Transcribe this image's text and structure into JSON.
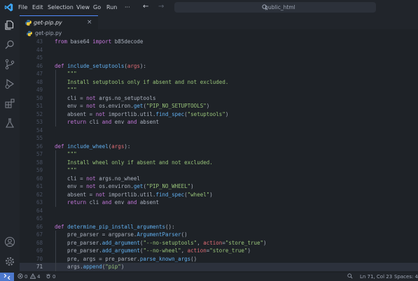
{
  "colors": {
    "accent": "#528bff",
    "remote": "#4d78cc",
    "keyword": "#c678dd",
    "function": "#61afef",
    "string": "#98c379",
    "param": "#e06c75"
  },
  "menu": [
    "File",
    "Edit",
    "Selection",
    "View",
    "Go",
    "Run",
    "···"
  ],
  "command_center": {
    "label": "public_html",
    "icon": "search-icon"
  },
  "activity_icons": [
    "explorer-icon",
    "search-icon",
    "source-control-icon",
    "run-debug-icon",
    "extensions-icon",
    "testing-icon",
    "account-icon",
    "settings-gear-icon"
  ],
  "tab": {
    "label": "get-pip.py",
    "close": "×"
  },
  "breadcrumb": {
    "file": "get-pip.py"
  },
  "editor": {
    "current_line": 71,
    "lines": [
      {
        "n": 43,
        "t": [
          [
            "kw",
            "from"
          ],
          [
            "tx",
            " base64 "
          ],
          [
            "kw",
            "import"
          ],
          [
            "tx",
            " b85decode"
          ]
        ]
      },
      {
        "n": 44,
        "t": []
      },
      {
        "n": 45,
        "t": []
      },
      {
        "n": 46,
        "t": [
          [
            "kw",
            "def"
          ],
          [
            "tx",
            " "
          ],
          [
            "fn",
            "include_setuptools"
          ],
          [
            "tx",
            "("
          ],
          [
            "pm",
            "args"
          ],
          [
            "tx",
            "):"
          ]
        ]
      },
      {
        "n": 47,
        "t": [
          [
            "st",
            "    \"\"\""
          ]
        ]
      },
      {
        "n": 48,
        "t": [
          [
            "st",
            "    Install setuptools only if absent and not excluded."
          ]
        ]
      },
      {
        "n": 49,
        "t": [
          [
            "st",
            "    \"\"\""
          ]
        ]
      },
      {
        "n": 50,
        "t": [
          [
            "tx",
            "    cli = "
          ],
          [
            "kw",
            "not"
          ],
          [
            "tx",
            " args.no_setuptools"
          ]
        ]
      },
      {
        "n": 51,
        "t": [
          [
            "tx",
            "    env = "
          ],
          [
            "kw",
            "not"
          ],
          [
            "tx",
            " os.environ."
          ],
          [
            "fn",
            "get"
          ],
          [
            "tx",
            "("
          ],
          [
            "st",
            "\"PIP_NO_SETUPTOOLS\""
          ],
          [
            "tx",
            ")"
          ]
        ]
      },
      {
        "n": 52,
        "t": [
          [
            "tx",
            "    absent = "
          ],
          [
            "kw",
            "not"
          ],
          [
            "tx",
            " importlib.util."
          ],
          [
            "fn",
            "find_spec"
          ],
          [
            "tx",
            "("
          ],
          [
            "st",
            "\"setuptools\""
          ],
          [
            "tx",
            ")"
          ]
        ]
      },
      {
        "n": 53,
        "t": [
          [
            "kw",
            "    return"
          ],
          [
            "tx",
            " cli "
          ],
          [
            "kw",
            "and"
          ],
          [
            "tx",
            " env "
          ],
          [
            "kw",
            "and"
          ],
          [
            "tx",
            " absent"
          ]
        ]
      },
      {
        "n": 54,
        "t": []
      },
      {
        "n": 55,
        "t": []
      },
      {
        "n": 56,
        "t": [
          [
            "kw",
            "def"
          ],
          [
            "tx",
            " "
          ],
          [
            "fn",
            "include_wheel"
          ],
          [
            "tx",
            "("
          ],
          [
            "pm",
            "args"
          ],
          [
            "tx",
            "):"
          ]
        ]
      },
      {
        "n": 57,
        "t": [
          [
            "st",
            "    \"\"\""
          ]
        ]
      },
      {
        "n": 58,
        "t": [
          [
            "st",
            "    Install wheel only if absent and not excluded."
          ]
        ]
      },
      {
        "n": 59,
        "t": [
          [
            "st",
            "    \"\"\""
          ]
        ]
      },
      {
        "n": 60,
        "t": [
          [
            "tx",
            "    cli = "
          ],
          [
            "kw",
            "not"
          ],
          [
            "tx",
            " args.no_wheel"
          ]
        ]
      },
      {
        "n": 61,
        "t": [
          [
            "tx",
            "    env = "
          ],
          [
            "kw",
            "not"
          ],
          [
            "tx",
            " os.environ."
          ],
          [
            "fn",
            "get"
          ],
          [
            "tx",
            "("
          ],
          [
            "st",
            "\"PIP_NO_WHEEL\""
          ],
          [
            "tx",
            ")"
          ]
        ]
      },
      {
        "n": 62,
        "t": [
          [
            "tx",
            "    absent = "
          ],
          [
            "kw",
            "not"
          ],
          [
            "tx",
            " importlib.util."
          ],
          [
            "fn",
            "find_spec"
          ],
          [
            "tx",
            "("
          ],
          [
            "st",
            "\"wheel\""
          ],
          [
            "tx",
            ")"
          ]
        ]
      },
      {
        "n": 63,
        "t": [
          [
            "kw",
            "    return"
          ],
          [
            "tx",
            " cli "
          ],
          [
            "kw",
            "and"
          ],
          [
            "tx",
            " env "
          ],
          [
            "kw",
            "and"
          ],
          [
            "tx",
            " absent"
          ]
        ]
      },
      {
        "n": 64,
        "t": []
      },
      {
        "n": 65,
        "t": []
      },
      {
        "n": 66,
        "t": [
          [
            "kw",
            "def"
          ],
          [
            "tx",
            " "
          ],
          [
            "fn",
            "determine_pip_install_arguments"
          ],
          [
            "tx",
            "():"
          ]
        ]
      },
      {
        "n": 67,
        "t": [
          [
            "tx",
            "    pre_parser = argparse."
          ],
          [
            "fn",
            "ArgumentParser"
          ],
          [
            "tx",
            "()"
          ]
        ]
      },
      {
        "n": 68,
        "t": [
          [
            "tx",
            "    pre_parser."
          ],
          [
            "fn",
            "add_argument"
          ],
          [
            "tx",
            "("
          ],
          [
            "st",
            "\"--no-setuptools\""
          ],
          [
            "tx",
            ", "
          ],
          [
            "pm",
            "action"
          ],
          [
            "tx",
            "="
          ],
          [
            "st",
            "\"store_true\""
          ],
          [
            "tx",
            ")"
          ]
        ]
      },
      {
        "n": 69,
        "t": [
          [
            "tx",
            "    pre_parser."
          ],
          [
            "fn",
            "add_argument"
          ],
          [
            "tx",
            "("
          ],
          [
            "st",
            "\"--no-wheel\""
          ],
          [
            "tx",
            ", "
          ],
          [
            "pm",
            "action"
          ],
          [
            "tx",
            "="
          ],
          [
            "st",
            "\"store_true\""
          ],
          [
            "tx",
            ")"
          ]
        ]
      },
      {
        "n": 70,
        "t": [
          [
            "tx",
            "    pre, args = pre_parser."
          ],
          [
            "fn",
            "parse_known_args"
          ],
          [
            "tx",
            "()"
          ]
        ]
      },
      {
        "n": 71,
        "t": [
          [
            "tx",
            "    args."
          ],
          [
            "fn",
            "append"
          ],
          [
            "tx",
            "("
          ],
          [
            "st",
            "\"pip\""
          ],
          [
            "tx",
            ")"
          ]
        ]
      }
    ]
  },
  "statusbar": {
    "errors": "0",
    "warnings": "4",
    "ports": "0",
    "cursor": "Ln 71, Col 23",
    "spaces": "Spaces: 4"
  }
}
